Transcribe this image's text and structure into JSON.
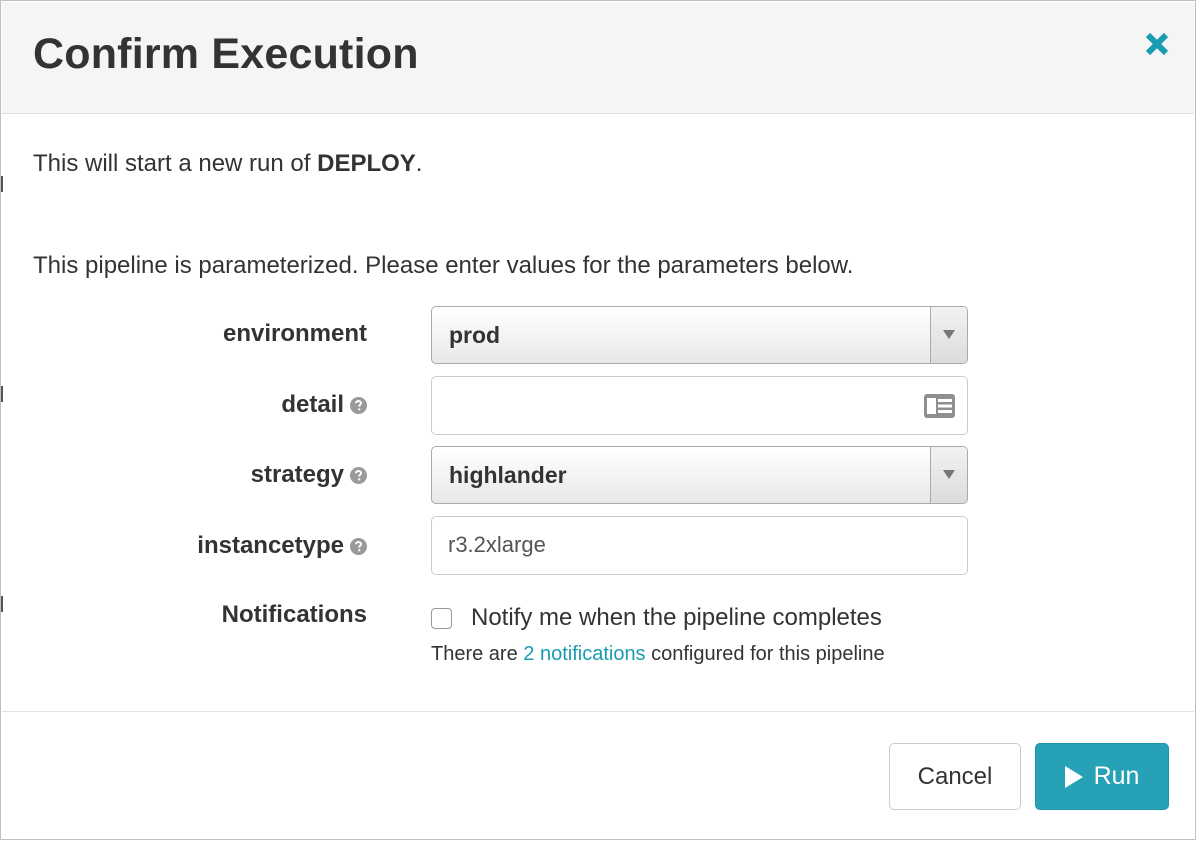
{
  "dialog": {
    "title": "Confirm Execution",
    "close_icon": "close-icon"
  },
  "intro": {
    "prefix": "This will start a new run of ",
    "pipeline_name": "DEPLOY",
    "suffix": "."
  },
  "parameters_note": "This pipeline is parameterized. Please enter values for the parameters below.",
  "fields": {
    "environment": {
      "label": "environment",
      "value": "prod",
      "control": "select"
    },
    "detail": {
      "label": "detail",
      "value": "",
      "placeholder": "",
      "help_icon": "question-circle-icon",
      "field_icon": "id-card-icon",
      "control": "text"
    },
    "strategy": {
      "label": "strategy",
      "value": "highlander",
      "help_icon": "question-circle-icon",
      "control": "select"
    },
    "instancetype": {
      "label": "instancetype",
      "value": "r3.2xlarge",
      "help_icon": "question-circle-icon",
      "control": "text"
    }
  },
  "notifications": {
    "label": "Notifications",
    "checkbox_label": "Notify me when the pipeline completes",
    "checked": false,
    "sub_prefix": "There are ",
    "sub_link": "2 notifications",
    "sub_suffix": " configured for this pipeline"
  },
  "footer": {
    "cancel_label": "Cancel",
    "run_label": "Run",
    "run_icon": "play-icon"
  },
  "colors": {
    "accent": "#27a1b6",
    "link": "#1a9cb0",
    "header_bg": "#f5f5f5",
    "text": "#333333"
  }
}
